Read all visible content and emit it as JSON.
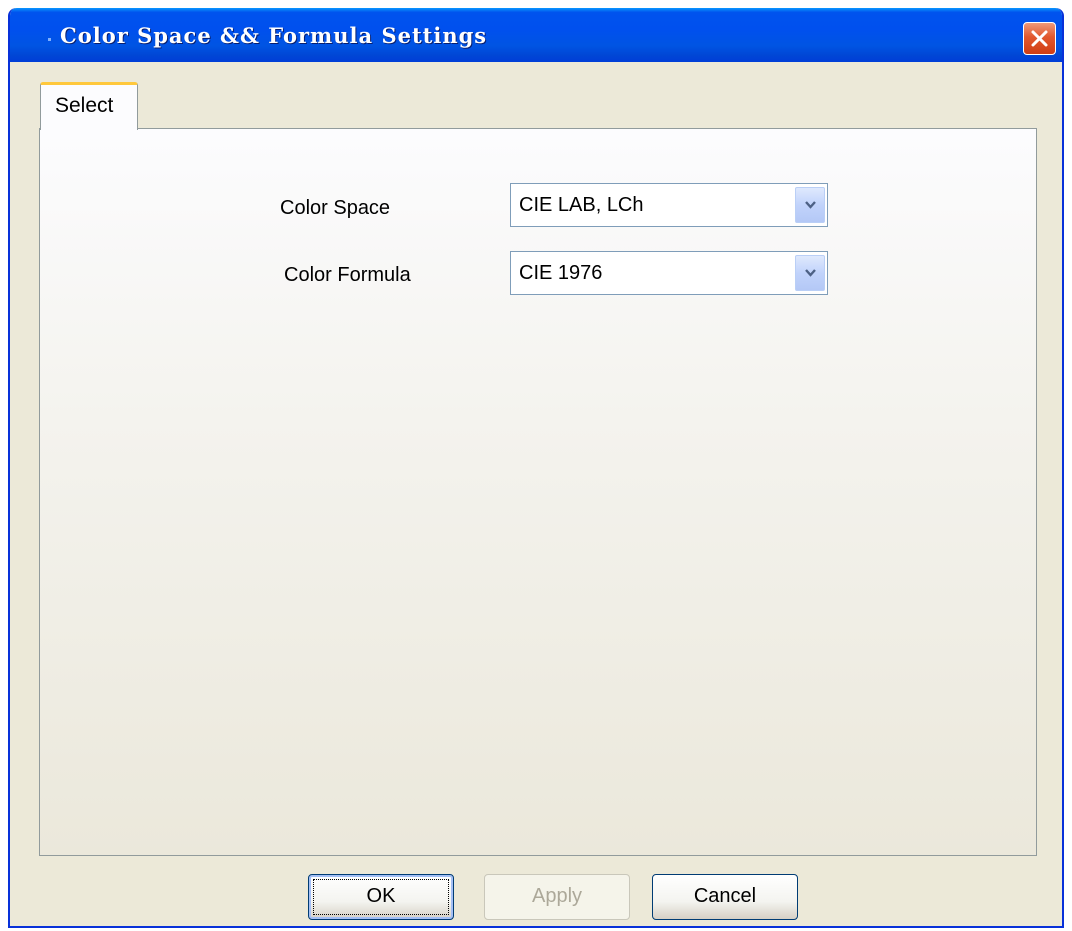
{
  "window": {
    "title": "Color Space && Formula Settings"
  },
  "tabs": [
    {
      "label": "Select",
      "selected": true
    }
  ],
  "form": {
    "color_space": {
      "label": "Color Space",
      "value": "CIE LAB, LCh"
    },
    "color_formula": {
      "label": "Color Formula",
      "value": "CIE 1976"
    }
  },
  "buttons": {
    "ok": {
      "label": "OK",
      "enabled": true
    },
    "apply": {
      "label": "Apply",
      "enabled": false
    },
    "cancel": {
      "label": "Cancel",
      "enabled": true
    }
  },
  "icons": {
    "close": "close-icon",
    "dropdown": "chevron-down-icon"
  },
  "colors": {
    "titlebar": "#0054e3",
    "close_button": "#e2582e",
    "dialog_background": "#ece9d8",
    "tab_accent": "#ffc83c"
  }
}
